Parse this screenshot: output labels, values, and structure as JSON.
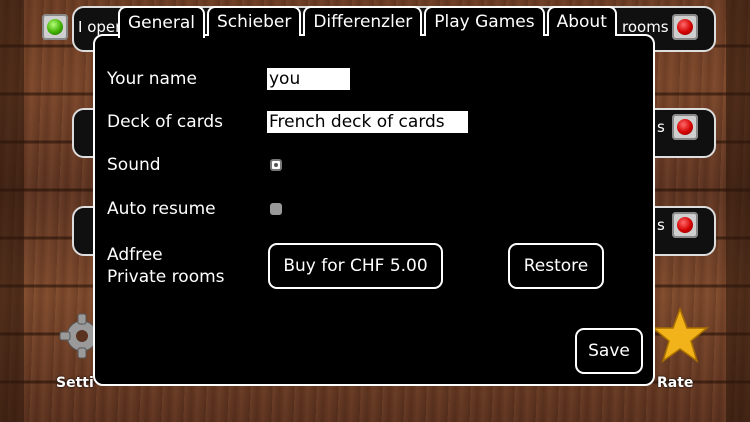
{
  "background": {
    "top_left_text": "I oper",
    "top_right_text": "rooms",
    "right_mid_text_1": "s",
    "right_mid_text_2": "s",
    "bottom_left_label": "Setti",
    "bottom_right_label": "Rate",
    "colors": {
      "led_red": "#d40000",
      "led_green": "#3fb000",
      "star": "#f2b21a"
    }
  },
  "tabs": [
    {
      "label": "General",
      "active": true
    },
    {
      "label": "Schieber",
      "active": false
    },
    {
      "label": "Differenzler",
      "active": false
    },
    {
      "label": "Play Games",
      "active": false
    },
    {
      "label": "About",
      "active": false
    }
  ],
  "settings": {
    "name_label": "Your name",
    "name_value": "you",
    "deck_label": "Deck of cards",
    "deck_value": "French deck of cards",
    "sound_label": "Sound",
    "sound_checked": true,
    "autoresume_label": "Auto resume",
    "autoresume_checked": false,
    "adfree_label_line1": "Adfree",
    "adfree_label_line2": "Private rooms",
    "buy_button": "Buy for CHF 5.00",
    "restore_button": "Restore",
    "save_button": "Save"
  }
}
